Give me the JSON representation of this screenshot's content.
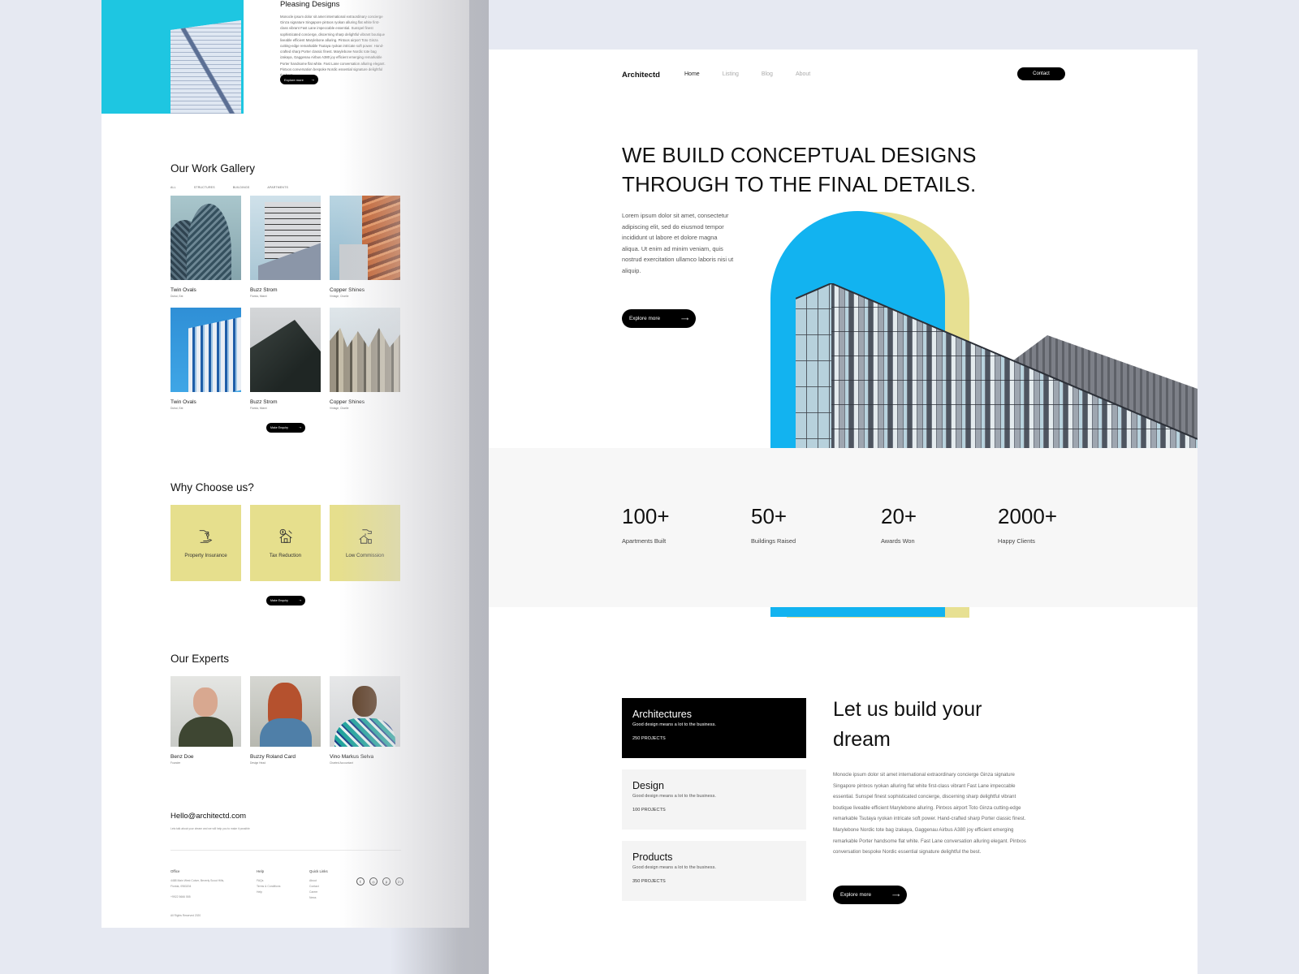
{
  "left_page": {
    "hero": {
      "title": "Pleasing Designs",
      "paragraph": "Monocle ipsum dolor sit amet international extraordinary concierge Ginza signature Singapore pintxos ryokan alluring flat white first-class vibrant Fast Lane impeccable essential. Sunspel finest sophisticated concierge, discerning sharp delightful vibrant boutique liveable efficient Marylebone alluring. Pintxos airport Toto Ginza cutting-edge remarkable Tsutaya ryokan intricate soft power. Hand-crafted sharp Porter classic finest. Marylebone Nordic tote bag izakaya, Gaggenau Airbus A380 joy efficient emerging remarkable Porter handsome flat white. Fast Lane conversation alluring elegant. Pintxos conversation bespoke Nordic essential signature delightful the best.",
      "button_label": "Explore more"
    },
    "gallery": {
      "title": "Our Work Gallery",
      "filters": [
        "ALL",
        "STRUCTURES",
        "BUILDINGS",
        "APARTMENTS"
      ],
      "items": [
        {
          "title": "Twin Ovals",
          "subtitle": "Dubai, Eat"
        },
        {
          "title": "Buzz Strom",
          "subtitle": "Florida, Miami"
        },
        {
          "title": "Copper Shines",
          "subtitle": "Vintage, Charlie"
        },
        {
          "title": "Twin Ovals",
          "subtitle": "Dubai, Eat"
        },
        {
          "title": "Buzz Strom",
          "subtitle": "Florida, Miami"
        },
        {
          "title": "Copper Shines",
          "subtitle": "Vintage, Charlie"
        }
      ],
      "button_label": "Make Enquiry"
    },
    "why": {
      "title": "Why Choose us?",
      "cards": [
        {
          "label": "Property Insurance",
          "icon": "hand-key-icon"
        },
        {
          "label": "Tax Reduction",
          "icon": "house-dollar-icon"
        },
        {
          "label": "Low Commission",
          "icon": "house-coins-icon"
        }
      ],
      "button_label": "Make Enquiry"
    },
    "experts": {
      "title": "Our Experts",
      "people": [
        {
          "name": "Benz Doe",
          "role": "Founder"
        },
        {
          "name": "Buzzy Roland Card",
          "role": "Design Head"
        },
        {
          "name": "Vino Markus Selva",
          "role": "Charted Accountant"
        }
      ]
    },
    "footer": {
      "email": "Hello@architectd.com",
      "email_sub": "Lets talk about your dream and we will help you to make it possible",
      "office": {
        "title": "Office",
        "lines": [
          "4488 Main West Culver, Beverly Scout Hills,",
          "Florida, 0983204"
        ],
        "phone": "+9922 5666 555"
      },
      "help": {
        "title": "Help",
        "links": [
          "FAQs",
          "Terms & Conditions",
          "Help"
        ]
      },
      "quick_links": {
        "title": "Quick Links",
        "links": [
          "About",
          "Contact",
          "Career",
          "News"
        ]
      },
      "social": [
        "twitter-icon",
        "instagram-icon",
        "pinterest-icon",
        "linkedin-icon"
      ],
      "copyright": "All Rights Reserved 2020"
    }
  },
  "right_page": {
    "nav": {
      "logo": "Architectd",
      "links": [
        "Home",
        "Listing",
        "Blog",
        "About"
      ],
      "active": "Home",
      "contact_label": "Contact"
    },
    "hero": {
      "title_line1": "WE BUILD CONCEPTUAL DESIGNS",
      "title_line2": "THROUGH TO THE FINAL DETAILS.",
      "paragraph": "Lorem ipsum dolor sit amet, consectetur adipiscing elit, sed do eiusmod tempor incididunt ut labore et dolore magna aliqua. Ut enim ad minim veniam, quis nostrud exercitation ullamco laboris nisi ut aliquip.",
      "button_label": "Explore more"
    },
    "stats": [
      {
        "value": "100+",
        "label": "Apartments Built"
      },
      {
        "value": "50+",
        "label": "Buildings Raised"
      },
      {
        "value": "20+",
        "label": "Awards Won"
      },
      {
        "value": "2000+",
        "label": "Happy Clients"
      }
    ],
    "services": [
      {
        "title": "Architectures",
        "desc": "Good design means a lot to the business.",
        "count": "250 PROJECTS"
      },
      {
        "title": "Design",
        "desc": "Good design means a lot to the business.",
        "count": "100 PROJECTS"
      },
      {
        "title": "Products",
        "desc": "Good design means a lot to the business.",
        "count": "350 PROJECTS"
      }
    ],
    "dream": {
      "title": "Let us build your dream",
      "paragraph": "Monocle ipsum dolor sit amet international extraordinary concierge Ginza signature Singapore pintxos ryokan alluring flat white first-class vibrant Fast Lane impeccable essential. Sunspel finest sophisticated concierge, discerning sharp delightful vibrant boutique liveable efficient Marylebone alluring. Pintxos airport Toto Ginza cutting-edge remarkable Tsutaya ryokan intricate soft power. Hand-crafted sharp Porter classic finest. Marylebone Nordic tote bag izakaya, Gaggenau Airbus A380 joy efficient emerging remarkable Porter handsome flat white. Fast Lane conversation alluring elegant. Pintxos conversation bespoke Nordic essential signature delightful the best.",
      "button_label": "Explore more"
    }
  },
  "colors": {
    "background": "#e6e9f2",
    "accent_blue": "#12b3f0",
    "accent_cyan": "#1ec6e1",
    "accent_yellow": "#e6df8d",
    "button_black": "#000000",
    "stats_band": "#f7f7f7"
  }
}
